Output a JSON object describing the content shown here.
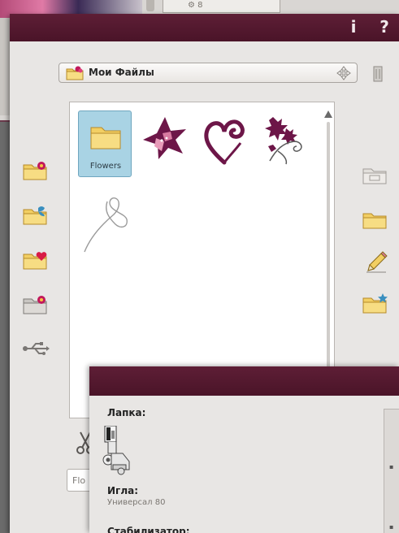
{
  "background_window": {
    "field_text": "⚙ 8"
  },
  "titlebar": {
    "info_button": "i",
    "help_button": "?"
  },
  "location": {
    "current_folder": "Мои Файлы"
  },
  "browser": {
    "items": [
      {
        "label": "Flowers",
        "type": "folder",
        "selected": true
      },
      {
        "label": "",
        "type": "design-star-flower"
      },
      {
        "label": "",
        "type": "design-heart-swirl"
      },
      {
        "label": "",
        "type": "design-leaf-spray"
      },
      {
        "label": "",
        "type": "design-heart-outline"
      }
    ]
  },
  "name_field": {
    "value": "Flo"
  },
  "info_popup": {
    "presser_foot_label": "Лапка:",
    "needle_label": "Игла:",
    "needle_value": "Универсал 80",
    "stabilizer_label": "Стабилизатор:"
  },
  "colors": {
    "titlebar": "#4a1428",
    "accent_magenta": "#8a1a4a",
    "selection": "#a9d3e4",
    "window_bg": "#e8e6e4"
  },
  "icons": {
    "left_column": [
      "folder-flower-icon",
      "folder-butterfly-icon",
      "folder-heart-icon",
      "folder-machine-icon",
      "usb-icon"
    ],
    "right_column": [
      "folder-open-empty-icon",
      "folder-plain-icon",
      "rename-pencil-icon",
      "new-folder-star-icon"
    ]
  }
}
